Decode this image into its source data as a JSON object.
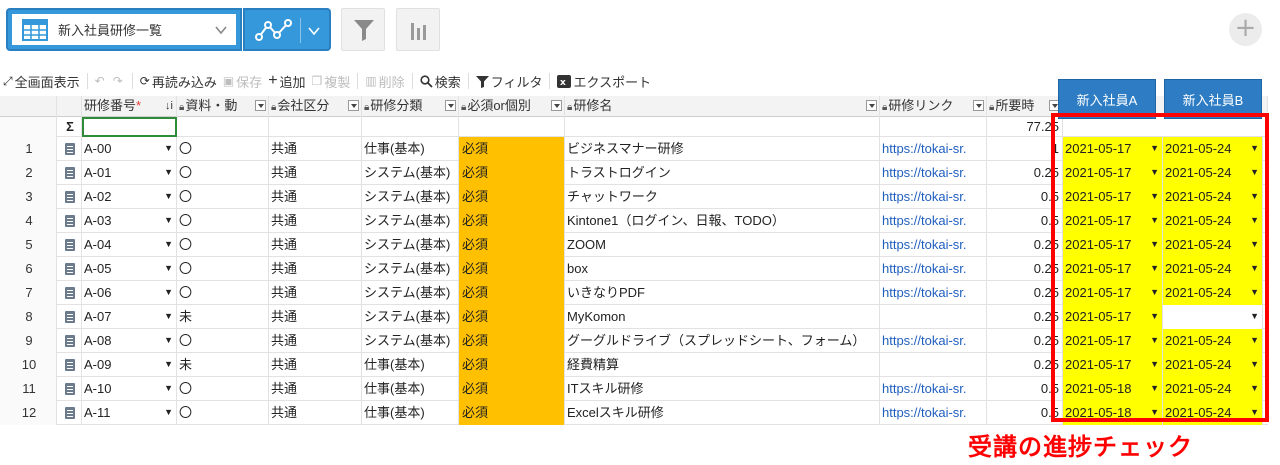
{
  "header": {
    "view_name": "新入社員研修一覧",
    "icons": [
      "table-icon",
      "chevron-down-icon",
      "graph-icon",
      "filter-icon",
      "bar-chart-icon",
      "plus-icon"
    ]
  },
  "toolbar": {
    "fullscreen": "全画面表示",
    "reload": "再読み込み",
    "save": "保存",
    "add": "追加",
    "duplicate": "複製",
    "delete": "削除",
    "search": "検索",
    "filter": "フィルタ",
    "export": "エクスポート"
  },
  "columns": {
    "id": "研修番号",
    "material": "資料・動",
    "division": "会社区分",
    "category": "研修分類",
    "required": "必須or個別",
    "name": "研修名",
    "link": "研修リンク",
    "duration": "所要時"
  },
  "trainees": [
    "新入社員A",
    "新入社員B"
  ],
  "summary": {
    "sigma": "Σ",
    "duration_total": "77.25"
  },
  "rows": [
    {
      "num": "1",
      "id": "A-00",
      "mat": "〇",
      "div": "共通",
      "cat": "仕事(基本)",
      "req": "必須",
      "name": "ビジネスマナー研修",
      "link": "https://tokai-sr.",
      "dur": "1",
      "a": "2021-05-17",
      "b": "2021-05-24"
    },
    {
      "num": "2",
      "id": "A-01",
      "mat": "〇",
      "div": "共通",
      "cat": "システム(基本)",
      "req": "必須",
      "name": "トラストログイン",
      "link": "https://tokai-sr.",
      "dur": "0.25",
      "a": "2021-05-17",
      "b": "2021-05-24"
    },
    {
      "num": "3",
      "id": "A-02",
      "mat": "〇",
      "div": "共通",
      "cat": "システム(基本)",
      "req": "必須",
      "name": "チャットワーク",
      "link": "https://tokai-sr.",
      "dur": "0.5",
      "a": "2021-05-17",
      "b": "2021-05-24"
    },
    {
      "num": "4",
      "id": "A-03",
      "mat": "〇",
      "div": "共通",
      "cat": "システム(基本)",
      "req": "必須",
      "name": "Kintone1（ログイン、日報、TODO）",
      "link": "https://tokai-sr.",
      "dur": "0.5",
      "a": "2021-05-17",
      "b": "2021-05-24"
    },
    {
      "num": "5",
      "id": "A-04",
      "mat": "〇",
      "div": "共通",
      "cat": "システム(基本)",
      "req": "必須",
      "name": "ZOOM",
      "link": "https://tokai-sr.",
      "dur": "0.25",
      "a": "2021-05-17",
      "b": "2021-05-24"
    },
    {
      "num": "6",
      "id": "A-05",
      "mat": "〇",
      "div": "共通",
      "cat": "システム(基本)",
      "req": "必須",
      "name": "box",
      "link": "https://tokai-sr.",
      "dur": "0.25",
      "a": "2021-05-17",
      "b": "2021-05-24"
    },
    {
      "num": "7",
      "id": "A-06",
      "mat": "〇",
      "div": "共通",
      "cat": "システム(基本)",
      "req": "必須",
      "name": "いきなりPDF",
      "link": "https://tokai-sr.",
      "dur": "0.25",
      "a": "2021-05-17",
      "b": "2021-05-24"
    },
    {
      "num": "8",
      "id": "A-07",
      "mat": "未",
      "div": "共通",
      "cat": "システム(基本)",
      "req": "必須",
      "name": "MyKomon",
      "link": "",
      "dur": "0.25",
      "a": "2021-05-17",
      "b": ""
    },
    {
      "num": "9",
      "id": "A-08",
      "mat": "〇",
      "div": "共通",
      "cat": "システム(基本)",
      "req": "必須",
      "name": "グーグルドライブ（スプレッドシート、フォーム）",
      "link": "https://tokai-sr.",
      "dur": "0.25",
      "a": "2021-05-17",
      "b": "2021-05-24"
    },
    {
      "num": "10",
      "id": "A-09",
      "mat": "未",
      "div": "共通",
      "cat": "仕事(基本)",
      "req": "必須",
      "name": "経費精算",
      "link": "",
      "dur": "0.25",
      "a": "2021-05-17",
      "b": "2021-05-24"
    },
    {
      "num": "11",
      "id": "A-10",
      "mat": "〇",
      "div": "共通",
      "cat": "仕事(基本)",
      "req": "必須",
      "name": "ITスキル研修",
      "link": "https://tokai-sr.",
      "dur": "0.5",
      "a": "2021-05-18",
      "b": "2021-05-24"
    },
    {
      "num": "12",
      "id": "A-11",
      "mat": "〇",
      "div": "共通",
      "cat": "仕事(基本)",
      "req": "必須",
      "name": "Excelスキル研修",
      "link": "https://tokai-sr.",
      "dur": "0.5",
      "a": "2021-05-18",
      "b": "2021-05-24"
    }
  ],
  "annotation": "受講の進捗チェック",
  "colors": {
    "header_blue": "#3498db",
    "required_orange": "#ffc000",
    "date_yellow": "#ffff00",
    "annotation_red": "#ff0000"
  }
}
